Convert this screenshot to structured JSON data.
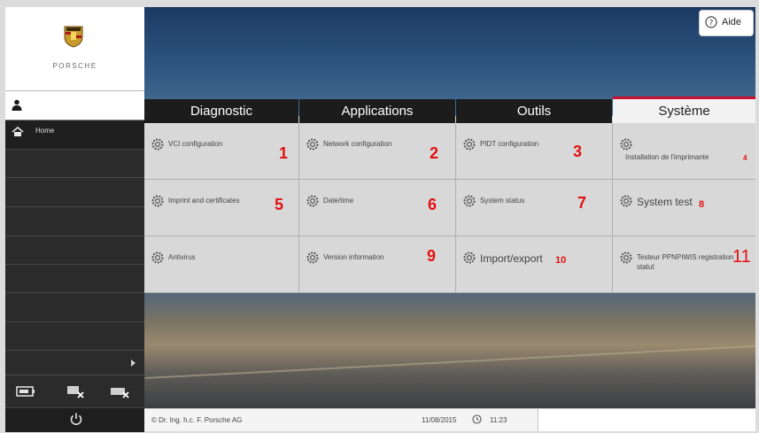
{
  "sidebar": {
    "brand": "PORSCHE",
    "home_label": "Home"
  },
  "header": {
    "help_label": "Aide"
  },
  "tabs": [
    {
      "label": "Diagnostic"
    },
    {
      "label": "Applications"
    },
    {
      "label": "Outils"
    },
    {
      "label": "Système",
      "active": true
    }
  ],
  "tiles": [
    {
      "label": "VCI configuration",
      "num": "1"
    },
    {
      "label": "Network configuration",
      "num": "2"
    },
    {
      "label": "PIDT configuration",
      "num": "3"
    },
    {
      "label": "Installation de l'imprimante",
      "num": "4"
    },
    {
      "label": "Imprint and certificates",
      "num": "5"
    },
    {
      "label": "Date/time",
      "num": "6"
    },
    {
      "label": "System status",
      "num": "7"
    },
    {
      "label": "System test",
      "num": "8"
    },
    {
      "label": "Antivirus",
      "num": ""
    },
    {
      "label": "Version information",
      "num": "9"
    },
    {
      "label": "Import/export",
      "num": "10"
    },
    {
      "label": "Testeur PPNPIWIS registration statut",
      "num": "11"
    }
  ],
  "footer": {
    "copyright": "© Dr. Ing. h.c. F. Porsche AG",
    "date": "11/08/2015",
    "time": "11:23"
  },
  "colors": {
    "accent_red": "#e31010",
    "active_tab_border": "#c8102e",
    "sidebar_bg": "#2b2b2b"
  }
}
